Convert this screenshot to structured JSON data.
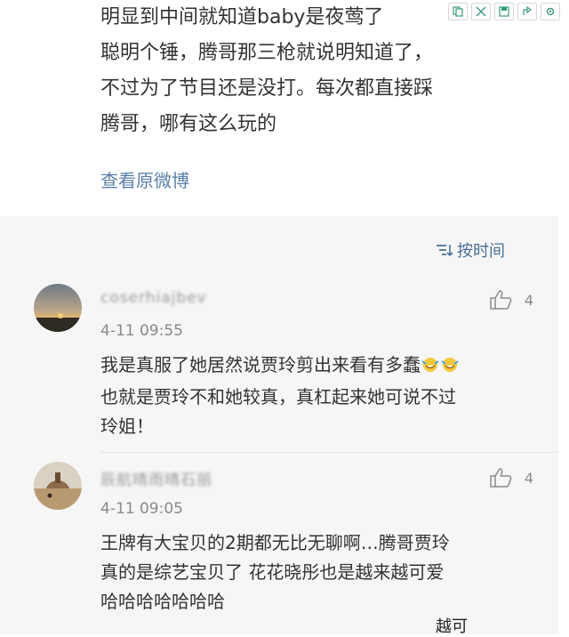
{
  "post": {
    "lines": [
      "明显到中间就知道baby是夜莺了",
      "聪明个锤，腾哥那三枪就说明知道了，",
      "不过为了节目还是没打。每次都直接踩",
      "腾哥，哪有这么玩的"
    ],
    "view_original": "查看原微博"
  },
  "sort": {
    "label": "按时间",
    "icon": "sort-icon"
  },
  "comments": [
    {
      "username": "coserhiajbev",
      "time": "4-11 09:55",
      "likes": "4",
      "lines": [
        "我是真服了她居然说贾玲剪出来看有多蠢",
        "也就是贾玲不和她较真，真杠起来她可说不过",
        "玲姐！"
      ]
    },
    {
      "username": "辰航晴雨晴石丽",
      "time": "4-11 09:05",
      "likes": "4",
      "lines": [
        "王牌有大宝贝的2期都无比无聊啊…腾哥贾玲",
        "真的是综艺宝贝了 花花晓彤也是越来越可爱",
        "哈哈哈哈哈哈哈"
      ]
    }
  ],
  "bottom_fragment": "越可",
  "colors": {
    "link": "#5a7fa8",
    "comment_bg": "#f6f6f6",
    "text": "#333333"
  }
}
